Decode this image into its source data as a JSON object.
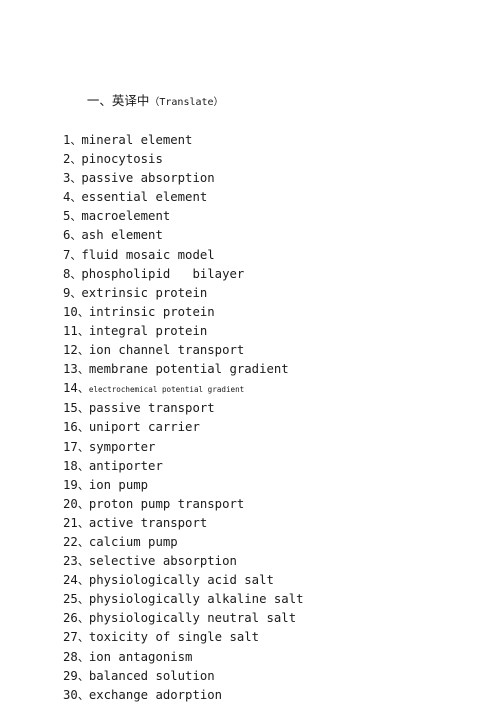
{
  "document": {
    "background_color": "#ffffff",
    "text_color": "#1a1a1a",
    "section": {
      "marker": "一、",
      "title_cjk": "英译中",
      "title_latin": "（Translate）",
      "full_heading": "一、英译中（Translate）"
    },
    "list_separator": "、",
    "items": [
      {
        "number": "1",
        "term": "mineral element",
        "size": "normal"
      },
      {
        "number": "2",
        "term": "pinocytosis",
        "size": "normal"
      },
      {
        "number": "3",
        "term": "passive absorption",
        "size": "normal"
      },
      {
        "number": "4",
        "term": "essential element",
        "size": "normal"
      },
      {
        "number": "5",
        "term": "macroelement",
        "size": "normal"
      },
      {
        "number": "6",
        "term": "ash element",
        "size": "normal"
      },
      {
        "number": "7",
        "term": "fluid mosaic model",
        "size": "normal"
      },
      {
        "number": "8",
        "term": "phospholipid   bilayer",
        "size": "normal"
      },
      {
        "number": "9",
        "term": "extrinsic protein",
        "size": "normal"
      },
      {
        "number": "10",
        "term": "intrinsic protein",
        "size": "normal"
      },
      {
        "number": "11",
        "term": "integral protein",
        "size": "normal"
      },
      {
        "number": "12",
        "term": "ion channel transport",
        "size": "normal"
      },
      {
        "number": "13",
        "term": "membrane potential gradient",
        "size": "normal"
      },
      {
        "number": "14",
        "term": "electrochemical potential gradient",
        "size": "small"
      },
      {
        "number": "15",
        "term": "passive transport",
        "size": "normal"
      },
      {
        "number": "16",
        "term": "uniport carrier",
        "size": "normal"
      },
      {
        "number": "17",
        "term": "symporter",
        "size": "normal"
      },
      {
        "number": "18",
        "term": "antiporter",
        "size": "normal"
      },
      {
        "number": "19",
        "term": "ion pump",
        "size": "normal"
      },
      {
        "number": "20",
        "term": "proton pump transport",
        "size": "normal"
      },
      {
        "number": "21",
        "term": "active transport",
        "size": "normal"
      },
      {
        "number": "22",
        "term": "calcium pump",
        "size": "normal"
      },
      {
        "number": "23",
        "term": "selective absorption",
        "size": "normal"
      },
      {
        "number": "24",
        "term": "physiologically acid salt",
        "size": "normal"
      },
      {
        "number": "25",
        "term": "physiologically alkaline salt",
        "size": "normal"
      },
      {
        "number": "26",
        "term": "physiologically neutral salt",
        "size": "normal"
      },
      {
        "number": "27",
        "term": "toxicity of single salt",
        "size": "normal"
      },
      {
        "number": "28",
        "term": "ion antagonism",
        "size": "normal"
      },
      {
        "number": "29",
        "term": "balanced solution",
        "size": "normal"
      },
      {
        "number": "30",
        "term": "exchange adorption",
        "size": "normal"
      }
    ]
  }
}
